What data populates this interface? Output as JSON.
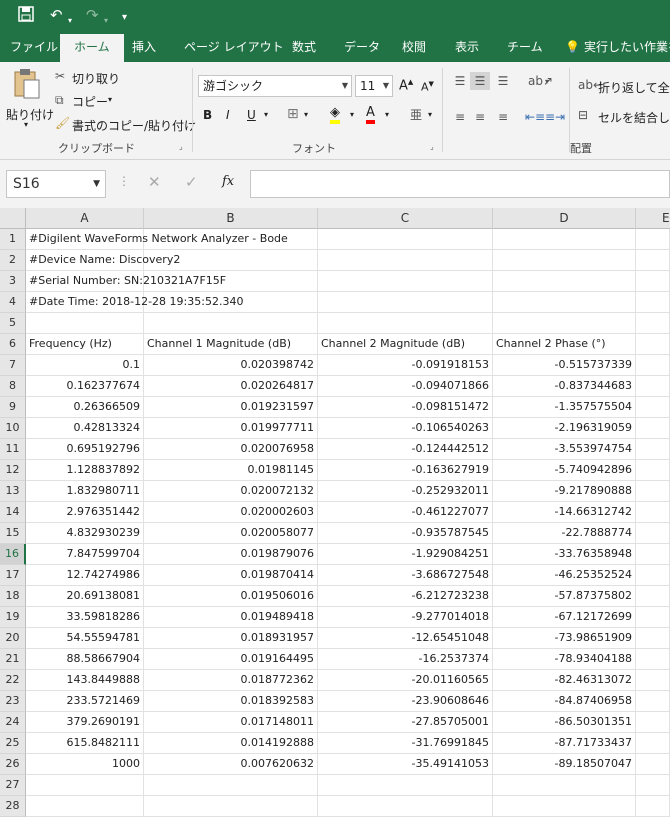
{
  "quick_access": {
    "save_icon": "save-icon",
    "undo_icon": "undo-icon",
    "redo_icon": "redo-icon",
    "customize_icon": "customize-icon"
  },
  "tabs": [
    "ファイル",
    "ホーム",
    "挿入",
    "ページ レイアウト",
    "数式",
    "データ",
    "校閲",
    "表示",
    "チーム"
  ],
  "active_tab": "ホーム",
  "tell_me": "実行したい作業を",
  "ribbon": {
    "clipboard": {
      "paste": "貼り付け",
      "cut": "切り取り",
      "copy": "コピー",
      "format_painter": "書式のコピー/貼り付け",
      "label": "クリップボード"
    },
    "font": {
      "name": "游ゴシック",
      "size": "11",
      "label": "フォント"
    },
    "alignment": {
      "wrap": "折り返して全体",
      "merge": "セルを結合して",
      "label": "配置"
    }
  },
  "formula_bar": {
    "name_box": "S16",
    "fx": "fx",
    "formula": ""
  },
  "sheet": {
    "columns": [
      "A",
      "B",
      "C",
      "D",
      "E"
    ],
    "rows": [
      [
        "#Digilent WaveForms Network Analyzer - Bode",
        "",
        "",
        ""
      ],
      [
        "#Device Name: Discovery2",
        "",
        "",
        ""
      ],
      [
        "#Serial Number: SN:210321A7F15F",
        "",
        "",
        ""
      ],
      [
        "#Date Time: 2018-12-28 19:35:52.340",
        "",
        "",
        ""
      ],
      [
        "",
        "",
        "",
        ""
      ],
      [
        "Frequency (Hz)",
        "Channel 1 Magnitude (dB)",
        "Channel 2 Magnitude (dB)",
        "Channel 2 Phase (°)"
      ],
      [
        "0.1",
        "0.020398742",
        "-0.091918153",
        "-0.515737339"
      ],
      [
        "0.162377674",
        "0.020264817",
        "-0.094071866",
        "-0.837344683"
      ],
      [
        "0.26366509",
        "0.019231597",
        "-0.098151472",
        "-1.357575504"
      ],
      [
        "0.42813324",
        "0.019977711",
        "-0.106540263",
        "-2.196319059"
      ],
      [
        "0.695192796",
        "0.020076958",
        "-0.124442512",
        "-3.553974754"
      ],
      [
        "1.128837892",
        "0.01981145",
        "-0.163627919",
        "-5.740942896"
      ],
      [
        "1.832980711",
        "0.020072132",
        "-0.252932011",
        "-9.217890888"
      ],
      [
        "2.976351442",
        "0.020002603",
        "-0.461227077",
        "-14.66312742"
      ],
      [
        "4.832930239",
        "0.020058077",
        "-0.935787545",
        "-22.7888774"
      ],
      [
        "7.847599704",
        "0.019879076",
        "-1.929084251",
        "-33.76358948"
      ],
      [
        "12.74274986",
        "0.019870414",
        "-3.686727548",
        "-46.25352524"
      ],
      [
        "20.69138081",
        "0.019506016",
        "-6.212723238",
        "-57.87375802"
      ],
      [
        "33.59818286",
        "0.019489418",
        "-9.277014018",
        "-67.12172699"
      ],
      [
        "54.55594781",
        "0.018931957",
        "-12.65451048",
        "-73.98651909"
      ],
      [
        "88.58667904",
        "0.019164495",
        "-16.2537374",
        "-78.93404188"
      ],
      [
        "143.8449888",
        "0.018772362",
        "-20.01160565",
        "-82.46313072"
      ],
      [
        "233.5721469",
        "0.018392583",
        "-23.90608646",
        "-84.87406958"
      ],
      [
        "379.2690191",
        "0.017148011",
        "-27.85705001",
        "-86.50301351"
      ],
      [
        "615.8482111",
        "0.014192888",
        "-31.76991845",
        "-87.71733437"
      ],
      [
        "1000",
        "0.007620632",
        "-35.49141053",
        "-89.18507047"
      ],
      [
        "",
        "",
        "",
        ""
      ],
      [
        "",
        "",
        "",
        ""
      ]
    ],
    "selected_row": 16
  }
}
